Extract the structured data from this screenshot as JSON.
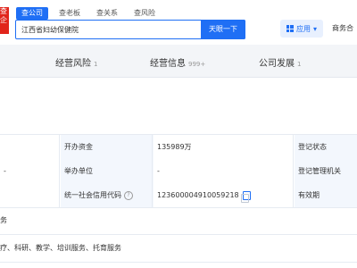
{
  "logo": {
    "text": "查企"
  },
  "tabs": [
    {
      "label": "查公司",
      "active": true
    },
    {
      "label": "查老板",
      "active": false
    },
    {
      "label": "查关系",
      "active": false
    },
    {
      "label": "查风险",
      "active": false
    }
  ],
  "search": {
    "value": "江西省妇幼保健院",
    "clear_glyph": "×",
    "button_label": "天眼一下"
  },
  "header": {
    "app_label": "应用",
    "app_caret": "▾",
    "biz_label": "商务合"
  },
  "subnav": [
    {
      "label": "经营风险",
      "count": "1"
    },
    {
      "label": "经营信息",
      "count": "999+"
    },
    {
      "label": "公司发展",
      "count": "1"
    }
  ],
  "info_table": {
    "rows": [
      {
        "left_value": "",
        "label1": "开办资金",
        "value1": "135989万",
        "label2": "登记状态"
      },
      {
        "left_value": "-",
        "label1": "举办单位",
        "value1": "-",
        "label2": "登记管理机关"
      },
      {
        "left_value": "",
        "label1": "统一社会信用代码",
        "value1": "123600004910059218",
        "label2": "有效期"
      }
    ]
  },
  "scope_line_a": "务",
  "scope_line_b": "疗、科研、教学、培训服务、托育服务",
  "colors": {
    "accent": "#1f6ff5",
    "brand_red": "#e1251b",
    "label_bg": "#f3f7fd"
  }
}
